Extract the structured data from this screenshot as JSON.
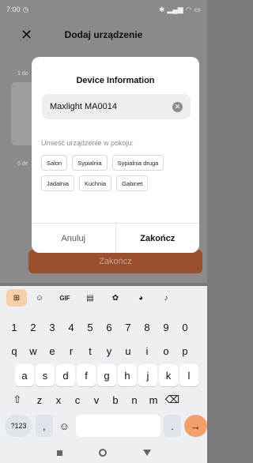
{
  "statusbar": {
    "time": "7:00",
    "right_icons": "bluetooth signal signal wifi battery"
  },
  "appbar": {
    "title": "Dodaj urządzenie",
    "close_glyph": "✕"
  },
  "background": {
    "step1_label": "1 do",
    "step2_label": "0 de",
    "finish_button": "Zakończ"
  },
  "dialog": {
    "title": "Device Information",
    "name_value": "Maxlight MA0014",
    "room_prompt": "Umieść urządzenie w pokoju:",
    "rooms": [
      "Salon",
      "Sypialnia",
      "Sypialnia druga",
      "Jadalnia",
      "Kuchnia",
      "Gabinet"
    ],
    "cancel_label": "Anuluj",
    "finish_label": "Zakończ"
  },
  "keyboard": {
    "toolbar": {
      "gif_label": "GIF"
    },
    "numbers": [
      "1",
      "2",
      "3",
      "4",
      "5",
      "6",
      "7",
      "8",
      "9",
      "0"
    ],
    "row_q": [
      "q",
      "w",
      "e",
      "r",
      "t",
      "y",
      "u",
      "i",
      "o",
      "p"
    ],
    "row_a": [
      "a",
      "s",
      "d",
      "f",
      "g",
      "h",
      "j",
      "k",
      "l"
    ],
    "row_z": [
      "z",
      "x",
      "c",
      "v",
      "b",
      "n",
      "m"
    ],
    "symbols_label": "?123",
    "comma": ",",
    "dot": "."
  },
  "colors": {
    "accent": "#e8691f",
    "dim_button": "#9c4f2c"
  }
}
